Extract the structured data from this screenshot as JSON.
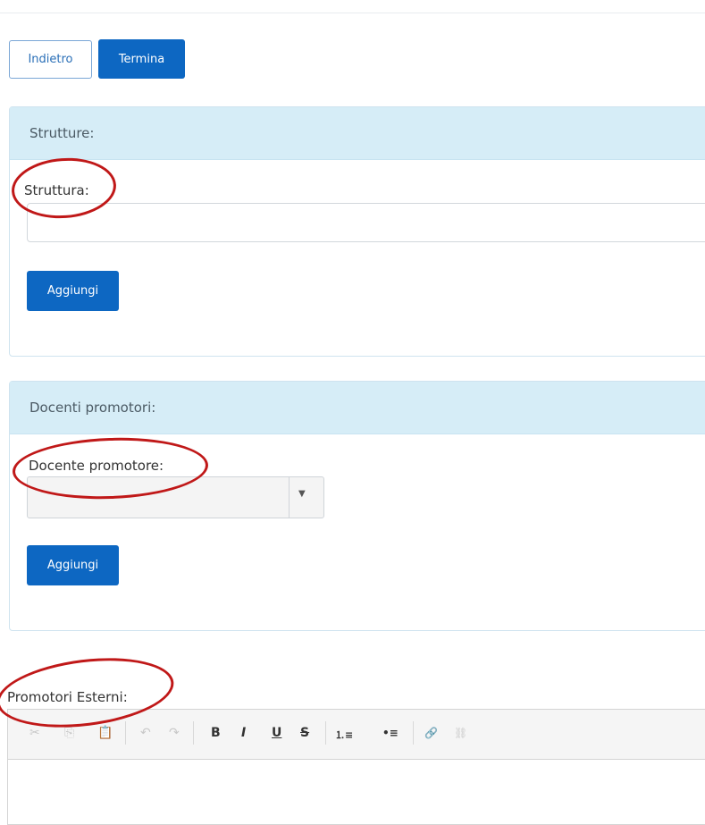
{
  "buttons": {
    "back": "Indietro",
    "finish": "Termina"
  },
  "structures_panel": {
    "title": "Strutture:",
    "field_label": "Struttura:",
    "field_value": "",
    "add_label": "Aggiungi"
  },
  "teachers_panel": {
    "title": "Docenti promotori:",
    "field_label": "Docente promotore:",
    "selected_value": "",
    "add_label": "Aggiungi"
  },
  "external_promoters": {
    "label": "Promotori Esterni:",
    "content": ""
  },
  "toolbar": {
    "cut": "✂",
    "copy": "⎘",
    "paste": "📋",
    "undo": "↶",
    "redo": "↷",
    "bold": "B",
    "italic": "I",
    "underline": "U",
    "strike": "S",
    "ordered_list": "⒈≡",
    "bullet_list": "•≡",
    "link": "🔗",
    "unlink": "⛓"
  },
  "colors": {
    "primary": "#0d67c2",
    "panel_header": "#d6edf7",
    "annotation": "#c01818"
  }
}
